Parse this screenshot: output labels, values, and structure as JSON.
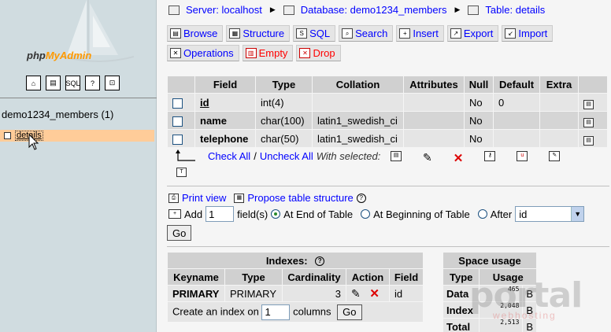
{
  "left": {
    "brand_prefix": "php",
    "brand_suffix": "MyAdmin",
    "icons": [
      "home-icon",
      "query-icon",
      "sql-icon",
      "docs-icon",
      "help-icon"
    ],
    "db_name": "demo1234_members (1)",
    "table_item": "details"
  },
  "breadcrumb": {
    "server": "Server: localhost",
    "database": "Database: demo1234_members",
    "table": "Table: details"
  },
  "tabs": {
    "browse": "Browse",
    "structure": "Structure",
    "sql": "SQL",
    "search": "Search",
    "insert": "Insert",
    "export": "Export",
    "import": "Import",
    "operations": "Operations",
    "empty": "Empty",
    "drop": "Drop"
  },
  "fields_table": {
    "headers": [
      "Field",
      "Type",
      "Collation",
      "Attributes",
      "Null",
      "Default",
      "Extra"
    ],
    "rows": [
      {
        "field": "id",
        "type": "int(4)",
        "collation": "",
        "attributes": "",
        "null": "No",
        "default": "0",
        "extra": ""
      },
      {
        "field": "name",
        "type": "char(100)",
        "collation": "latin1_swedish_ci",
        "attributes": "",
        "null": "No",
        "default": "",
        "extra": ""
      },
      {
        "field": "telephone",
        "type": "char(50)",
        "collation": "latin1_swedish_ci",
        "attributes": "",
        "null": "No",
        "default": "",
        "extra": ""
      }
    ]
  },
  "checkrow": {
    "check_all": "Check All",
    "sep": "/",
    "uncheck_all": "Uncheck All",
    "with_selected": "With selected:"
  },
  "print_view": "Print view",
  "propose": "Propose table structure",
  "add": {
    "label": "Add",
    "count": "1",
    "fields_label": "field(s)",
    "at_end": "At End of Table",
    "at_beginning": "At Beginning of Table",
    "after": "After",
    "after_value": "id",
    "go": "Go"
  },
  "indexes": {
    "title": "Indexes:",
    "headers": [
      "Keyname",
      "Type",
      "Cardinality",
      "Action",
      "Field"
    ],
    "row": {
      "keyname": "PRIMARY",
      "type": "PRIMARY",
      "cardinality": "3",
      "field": "id"
    },
    "create_label": "Create an index on",
    "create_count": "1",
    "columns_label": "columns",
    "go": "Go"
  },
  "space": {
    "title": "Space usage",
    "headers": [
      "Type",
      "Usage"
    ],
    "rows": [
      {
        "type": "Data",
        "value": "465",
        "unit": "B"
      },
      {
        "type": "Index",
        "value": "2,048",
        "unit": "B"
      },
      {
        "type": "Total",
        "value": "2,513",
        "unit": "B"
      }
    ]
  },
  "watermark": {
    "line1": "portal",
    "line2": "webhosting"
  }
}
